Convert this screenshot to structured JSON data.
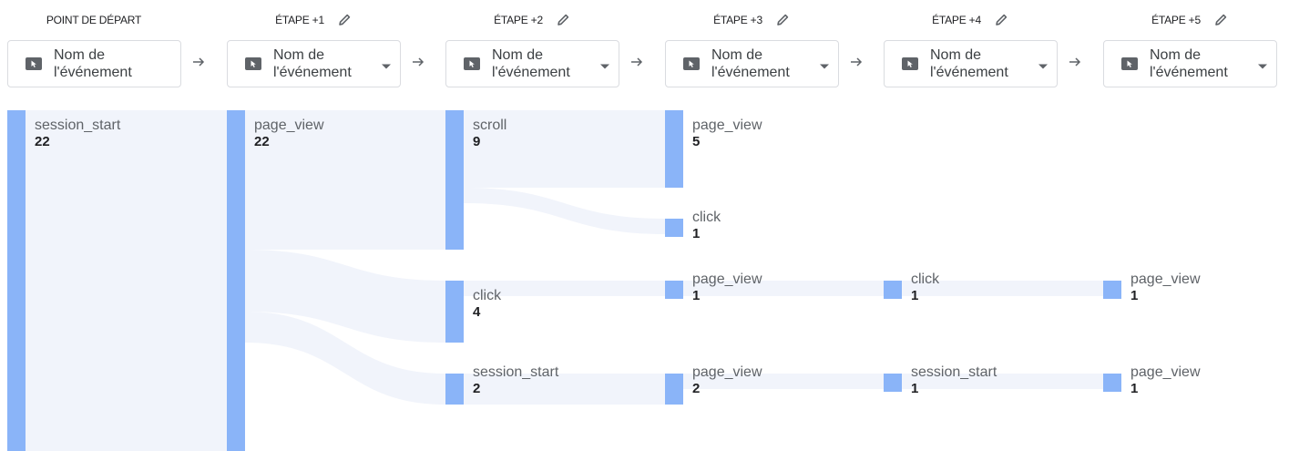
{
  "steps": [
    {
      "header": "POINT DE DÉPART",
      "editable": false,
      "selector_line1": "Nom de",
      "selector_line2": "l'événement",
      "dropdown": false
    },
    {
      "header": "ÉTAPE +1",
      "editable": true,
      "selector_line1": "Nom de",
      "selector_line2": "l'événement",
      "dropdown": true
    },
    {
      "header": "ÉTAPE +2",
      "editable": true,
      "selector_line1": "Nom de",
      "selector_line2": "l'événement",
      "dropdown": true
    },
    {
      "header": "ÉTAPE +3",
      "editable": true,
      "selector_line1": "Nom de",
      "selector_line2": "l'événement",
      "dropdown": true
    },
    {
      "header": "ÉTAPE +4",
      "editable": true,
      "selector_line1": "Nom de",
      "selector_line2": "l'événement",
      "dropdown": true
    },
    {
      "header": "ÉTAPE +5",
      "editable": true,
      "selector_line1": "Nom de",
      "selector_line2": "l'événement",
      "dropdown": true
    }
  ],
  "icons": {
    "pencil": "pencil-icon",
    "event": "cursor-event-icon",
    "caret": "caret-down-icon",
    "arrow": "arrow-right-icon"
  },
  "colors": {
    "node": "#8ab4f8",
    "link": "#f1f4fb",
    "text": "#202124",
    "label": "#5f6368"
  },
  "flow": {
    "nodes": [
      {
        "id": "n0",
        "step": 0,
        "event": "session_start",
        "count": 22
      },
      {
        "id": "n1",
        "step": 1,
        "event": "page_view",
        "count": 22
      },
      {
        "id": "n2a",
        "step": 2,
        "event": "scroll",
        "count": 9
      },
      {
        "id": "n2b",
        "step": 2,
        "event": "click",
        "count": 4
      },
      {
        "id": "n2c",
        "step": 2,
        "event": "session_start",
        "count": 2
      },
      {
        "id": "n3a",
        "step": 3,
        "event": "page_view",
        "count": 5
      },
      {
        "id": "n3b",
        "step": 3,
        "event": "click",
        "count": 1
      },
      {
        "id": "n3c",
        "step": 3,
        "event": "page_view",
        "count": 1
      },
      {
        "id": "n3d",
        "step": 3,
        "event": "page_view",
        "count": 2
      },
      {
        "id": "n4a",
        "step": 4,
        "event": "click",
        "count": 1
      },
      {
        "id": "n4b",
        "step": 4,
        "event": "session_start",
        "count": 1
      },
      {
        "id": "n5a",
        "step": 5,
        "event": "page_view",
        "count": 1
      },
      {
        "id": "n5b",
        "step": 5,
        "event": "page_view",
        "count": 1
      }
    ],
    "links": [
      {
        "from": "n0",
        "to": "n1",
        "value": 22
      },
      {
        "from": "n1",
        "to": "n2a",
        "value": 9
      },
      {
        "from": "n1",
        "to": "n2b",
        "value": 4
      },
      {
        "from": "n1",
        "to": "n2c",
        "value": 2
      },
      {
        "from": "n2a",
        "to": "n3a",
        "value": 5
      },
      {
        "from": "n2a",
        "to": "n3b",
        "value": 1
      },
      {
        "from": "n2b",
        "to": "n3c",
        "value": 1
      },
      {
        "from": "n2c",
        "to": "n3d",
        "value": 2
      },
      {
        "from": "n3c",
        "to": "n4a",
        "value": 1
      },
      {
        "from": "n3d",
        "to": "n4b",
        "value": 1
      },
      {
        "from": "n4a",
        "to": "n5a",
        "value": 1
      },
      {
        "from": "n4b",
        "to": "n5b",
        "value": 1
      }
    ]
  }
}
